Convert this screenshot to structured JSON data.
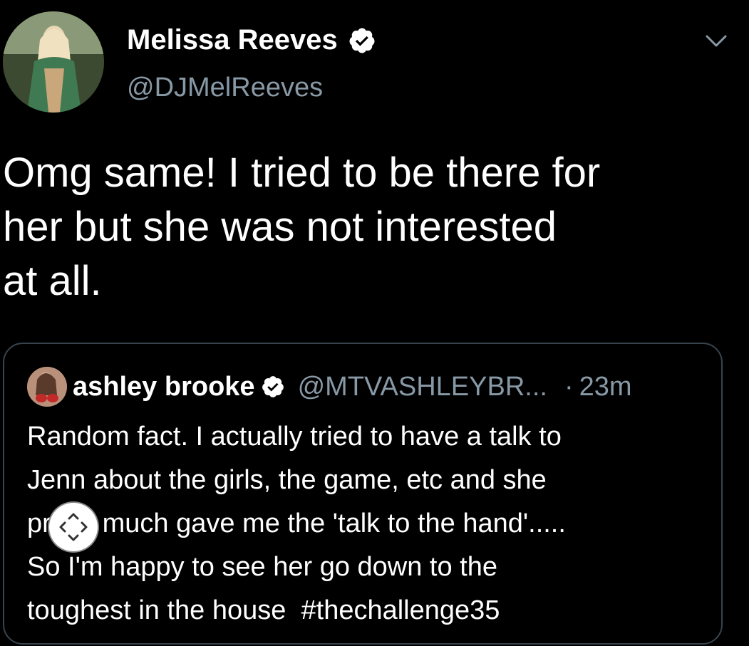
{
  "tweet": {
    "author_name": "Melissa Reeves",
    "author_handle": "@DJMelReeves",
    "text": "Omg same! I tried to be there for\nher but she was not interested\nat all."
  },
  "quoted_tweet": {
    "author_name": "ashley brooke",
    "author_handle": "@MTVASHLEYBR...",
    "separator": "·",
    "time": "23m",
    "text": "Random fact. I actually tried to have a talk to\nJenn about the girls, the game, etc and she\npretty much gave me the 'talk to the hand'.....\nSo I'm happy to see her go down to the\ntoughest in the house  #thechallenge35"
  },
  "icons": {
    "verified": "verified-badge-icon",
    "menu": "chevron-down-icon",
    "expand": "expand-arrows-icon"
  },
  "colors": {
    "background": "#000000",
    "text": "#ffffff",
    "secondary": "#8899a6",
    "border": "#38444d"
  }
}
